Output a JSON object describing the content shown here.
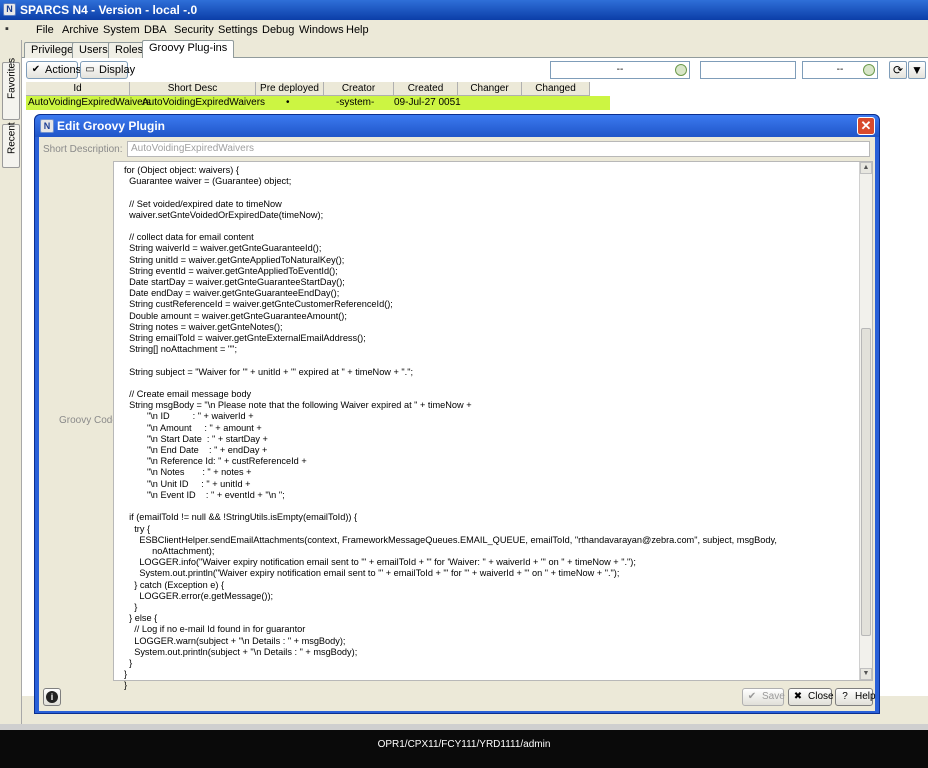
{
  "window": {
    "title": "SPARCS N4 - Version - local -.0"
  },
  "menu": [
    "File",
    "Archive",
    "System",
    "DBA",
    "Security",
    "Settings",
    "Debug",
    "Windows",
    "Help"
  ],
  "left_tabs": [
    "Favorites",
    "Recent"
  ],
  "tabs": [
    "Privileges",
    "Users",
    "Roles",
    "Groovy Plug-ins"
  ],
  "toolbar": {
    "actions_label": "Actions",
    "display_label": "Display",
    "combo1_value": "--",
    "combo2_value": "--"
  },
  "table": {
    "columns": [
      "Id",
      "Short Desc",
      "Pre deployed",
      "Creator",
      "Created",
      "Changer",
      "Changed"
    ],
    "rows": [
      {
        "id": "AutoVoidingExpiredWaivers",
        "short_desc": "AutoVoidingExpiredWaivers",
        "pre_deployed": "•",
        "creator": "-system-",
        "created": "09-Jul-27 0051",
        "changer": "",
        "changed": ""
      }
    ]
  },
  "dialog": {
    "title": "Edit Groovy Plugin",
    "short_desc_label": "Short Description:",
    "short_desc_value": "AutoVoidingExpiredWaivers",
    "code_label": "Groovy Code:",
    "code": "for (Object object: waivers) {\n  Guarantee waiver = (Guarantee) object;\n\n  // Set voided/expired date to timeNow\n  waiver.setGnteVoidedOrExpiredDate(timeNow);\n\n  // collect data for email content\n  String waiverId = waiver.getGnteGuaranteeId();\n  String unitId = waiver.getGnteAppliedToNaturalKey();\n  String eventId = waiver.getGnteAppliedToEventId();\n  Date startDay = waiver.getGnteGuaranteeStartDay();\n  Date endDay = waiver.getGnteGuaranteeEndDay();\n  String custReferenceId = waiver.getGnteCustomerReferenceId();\n  Double amount = waiver.getGnteGuaranteeAmount();\n  String notes = waiver.getGnteNotes();\n  String emailToId = waiver.getGnteExternalEmailAddress();\n  String[] noAttachment = \"\";\n\n  String subject = \"Waiver for '\" + unitId + \"' expired at \" + timeNow + \".\";\n\n  // Create email message body\n  String msgBody = \"\\n Please note that the following Waiver expired at \" + timeNow +\n         \"\\n ID         : \" + waiverId +\n         \"\\n Amount     : \" + amount +\n         \"\\n Start Date  : \" + startDay +\n         \"\\n End Date    : \" + endDay +\n         \"\\n Reference Id: \" + custReferenceId +\n         \"\\n Notes       : \" + notes +\n         \"\\n Unit ID     : \" + unitId +\n         \"\\n Event ID    : \" + eventId + \"\\n \";\n\n  if (emailToId != null && !StringUtils.isEmpty(emailToId)) {\n    try {\n      ESBClientHelper.sendEmailAttachments(context, FrameworkMessageQueues.EMAIL_QUEUE, emailToId, \"rthandavarayan@zebra.com\", subject, msgBody,\n           noAttachment);\n      LOGGER.info(\"Waiver expiry notification email sent to '\" + emailToId + \"' for 'Waiver: \" + waiverId + \"' on \" + timeNow + \".\");\n      System.out.println(\"Waiver expiry notification email sent to '\" + emailToId + \"' for '\" + waiverId + \"' on \" + timeNow + \".\");\n    } catch (Exception e) {\n      LOGGER.error(e.getMessage());\n    }\n  } else {\n    // Log if no e-mail Id found in for guarantor\n    LOGGER.warn(subject + \"\\n Details : \" + msgBody);\n    System.out.println(subject + \"\\n Details : \" + msgBody);\n  }\n}\n}",
    "save_label": "Save",
    "close_label": "Close",
    "help_label": "Help"
  },
  "status": {
    "text": "OPR1/CPX11/FCY111/YRD1111/admin"
  },
  "colors": {
    "title_blue": "#2960d8",
    "selected_row": "#ccf542",
    "close_red": "#d84a2c"
  }
}
